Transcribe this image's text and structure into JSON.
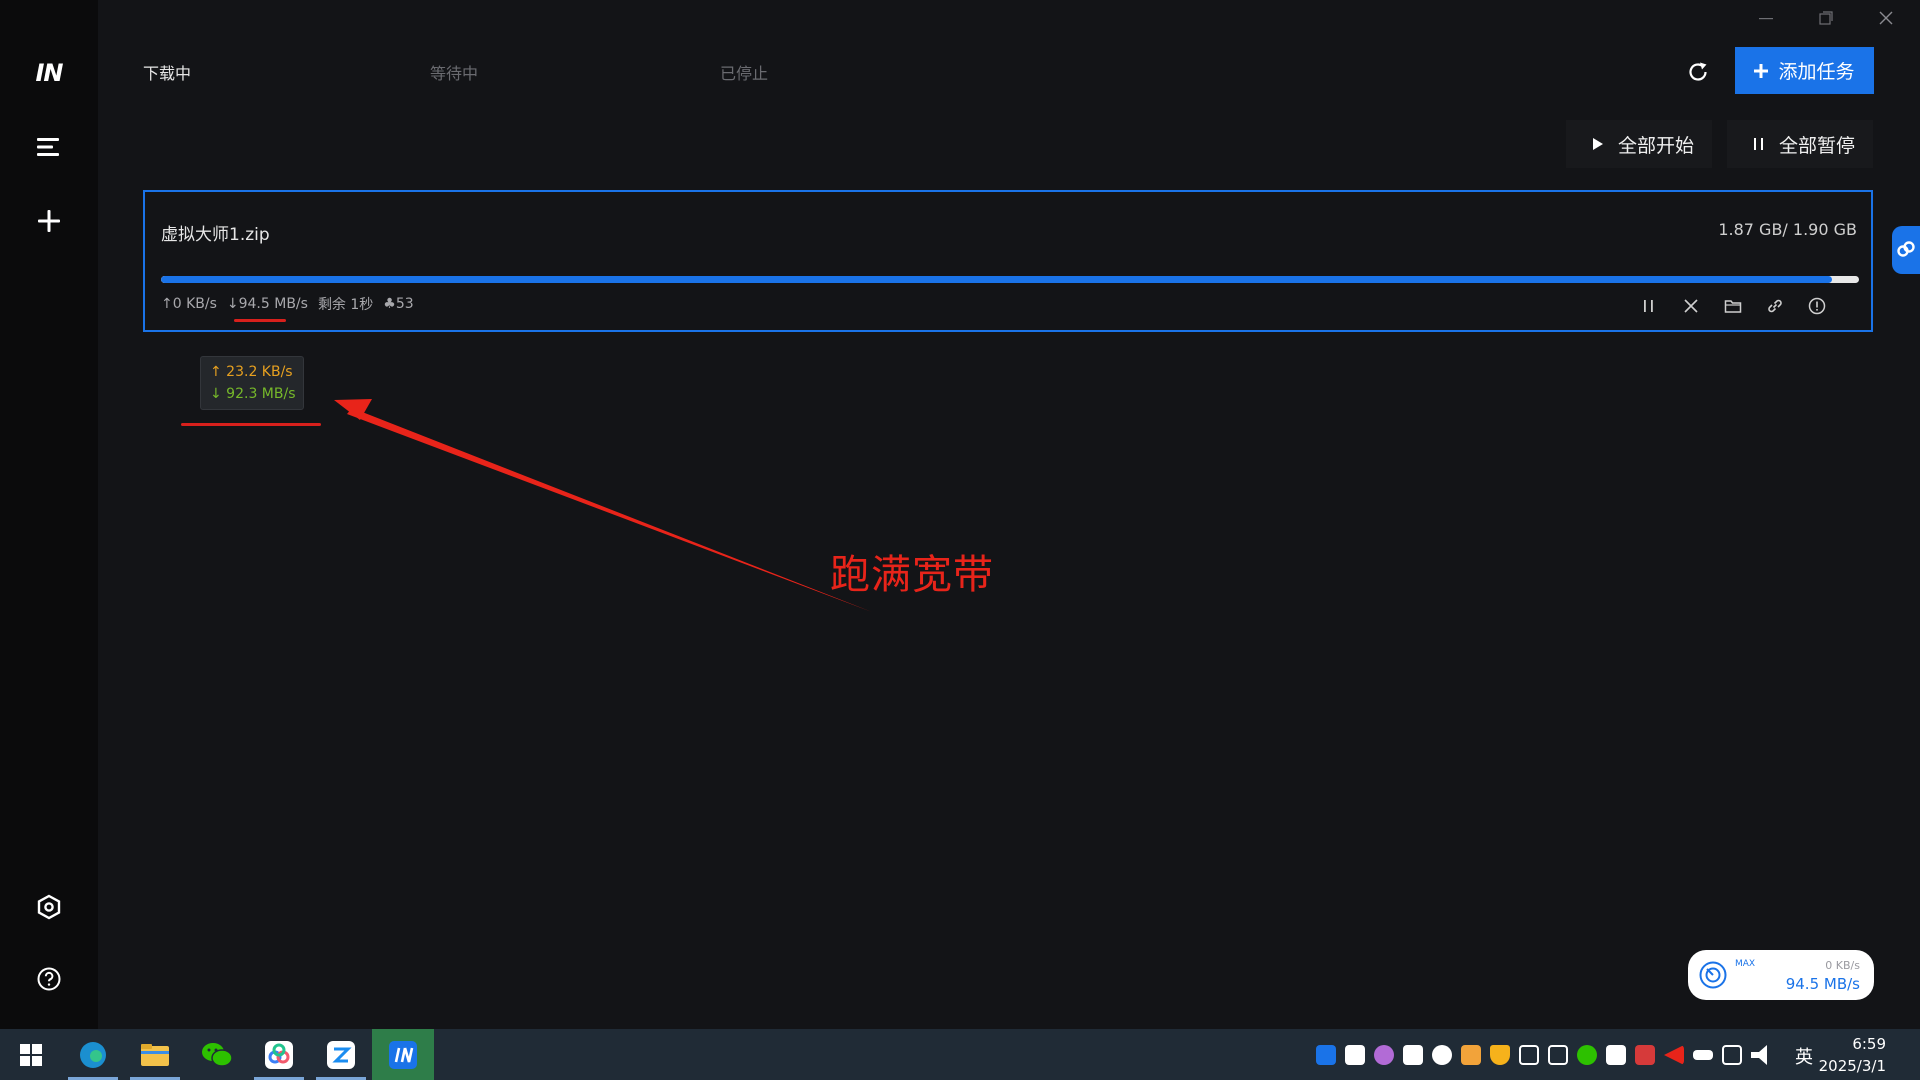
{
  "window": {
    "logo_text": "IN"
  },
  "tabs": [
    {
      "label": "下载中",
      "active": true
    },
    {
      "label": "等待中",
      "active": false
    },
    {
      "label": "已停止",
      "active": false
    }
  ],
  "toolbar": {
    "add_task_label": "添加任务",
    "start_all_label": "全部开始",
    "pause_all_label": "全部暂停"
  },
  "task": {
    "name": "虚拟大师1.zip",
    "size": "1.87 GB/ 1.90 GB",
    "progress_fraction": 0.984,
    "upload_speed": "↑0 KB/s",
    "download_speed": "↓94.5 MB/s",
    "remaining": "剩余 1秒",
    "peers": "♣53"
  },
  "tooltip": {
    "upload": "↑ 23.2 KB/s",
    "download": "↓ 92.3 MB/s"
  },
  "annotation": {
    "text": "跑满宽带"
  },
  "speed_widget": {
    "max_label": "MAX",
    "upload": "0 KB/s",
    "download": "94.5 MB/s"
  },
  "taskbar": {
    "time": "6:59",
    "date": "2025/3/1",
    "lang": "英"
  },
  "colors": {
    "accent": "#1a73e8",
    "annotation": "#e8241a",
    "up_speed": "#e6a020",
    "down_speed": "#76b82a"
  }
}
